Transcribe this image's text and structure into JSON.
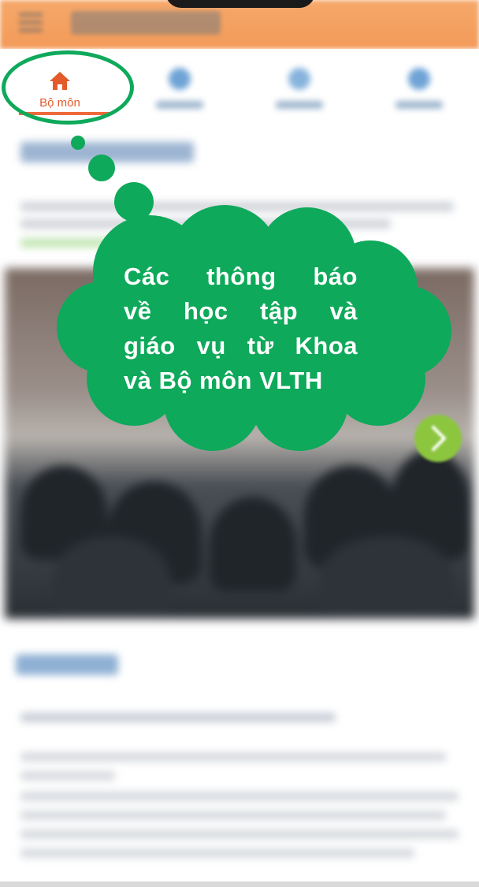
{
  "tabs": [
    {
      "label": "Bộ môn",
      "icon": "home-icon",
      "active": true
    },
    {
      "label": "",
      "icon": "chat-icon",
      "active": false
    },
    {
      "label": "",
      "icon": "chat-icon",
      "active": false
    },
    {
      "label": "",
      "icon": "chat-icon",
      "active": false
    }
  ],
  "callout": {
    "lines": [
      "Các thông báo",
      "về học tập và",
      "giáo vụ từ Khoa",
      "và Bộ môn VLTH"
    ]
  },
  "colors": {
    "header": "#f39a58",
    "active_tab": "#e35b2b",
    "callout_green": "#0ea95a",
    "arrow_button": "#8cc63f"
  }
}
